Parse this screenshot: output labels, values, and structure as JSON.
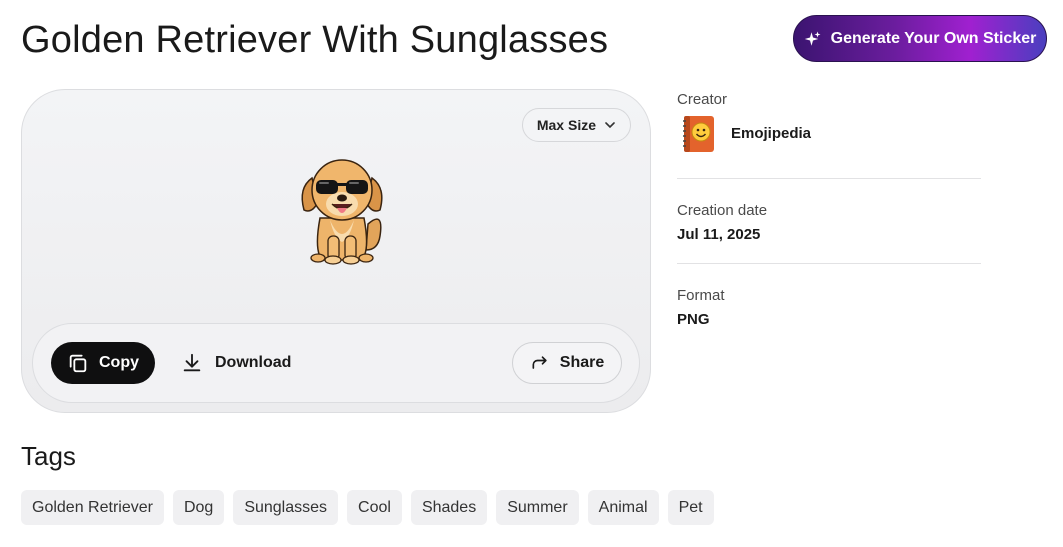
{
  "page": {
    "title": "Golden Retriever With Sunglasses"
  },
  "generate_button": {
    "label": "Generate Your Own Sticker",
    "icon": "sparkle-icon"
  },
  "preview": {
    "size_select": {
      "value": "Max Size",
      "icon": "chevron-down-icon"
    },
    "sticker_alt": "golden retriever puppy wearing sunglasses sticker"
  },
  "actions": {
    "copy_label": "Copy",
    "download_label": "Download",
    "share_label": "Share"
  },
  "meta": {
    "creator_label": "Creator",
    "creator_name": "Emojipedia",
    "date_label": "Creation date",
    "date_value": "Jul 11, 2025",
    "format_label": "Format",
    "format_value": "PNG"
  },
  "tags": {
    "title": "Tags",
    "items": [
      "Golden Retriever",
      "Dog",
      "Sunglasses",
      "Cool",
      "Shades",
      "Summer",
      "Animal",
      "Pet"
    ]
  },
  "colors": {
    "accent_start": "#3b1470",
    "accent_mid": "#a020d0",
    "accent_end": "#4a3fbf",
    "copy_bg": "#0f0f10"
  }
}
